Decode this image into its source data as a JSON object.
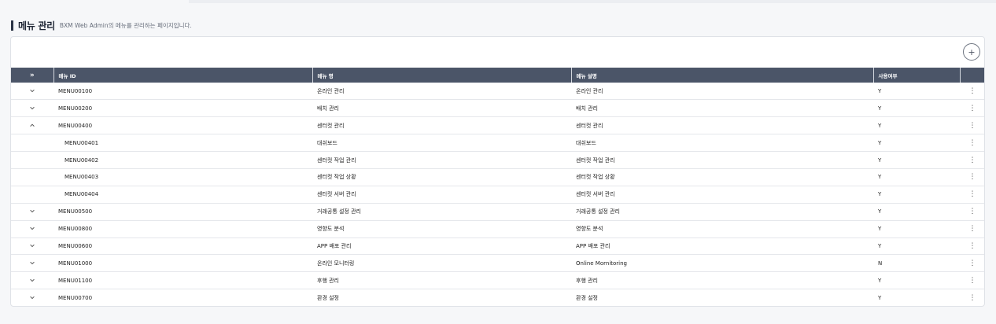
{
  "header": {
    "title": "메뉴 관리",
    "description": "BXM Web Admin의 메뉴를 관리하는 페이지입니다."
  },
  "toolbar": {
    "add_icon": "plus-icon",
    "add_label": "+"
  },
  "table": {
    "expand_all_icon": "double-chevron-right-icon",
    "expand_all_label": "»",
    "columns": [
      "메뉴 ID",
      "메뉴 명",
      "메뉴 설명",
      "사용여부"
    ],
    "rows": [
      {
        "id": "MENU00100",
        "name": "온라인 관리",
        "desc": "온라인 관리",
        "use": "Y",
        "toggle": "collapsed",
        "child": false
      },
      {
        "id": "MENU00200",
        "name": "배치 관리",
        "desc": "배치 관리",
        "use": "Y",
        "toggle": "collapsed",
        "child": false
      },
      {
        "id": "MENU00400",
        "name": "센터컷 관리",
        "desc": "센터컷 관리",
        "use": "Y",
        "toggle": "expanded",
        "child": false
      },
      {
        "id": "MENU00401",
        "name": "대쉬보드",
        "desc": "대쉬보드",
        "use": "Y",
        "toggle": "none",
        "child": true
      },
      {
        "id": "MENU00402",
        "name": "센터컷 작업 관리",
        "desc": "센터컷 작업 관리",
        "use": "Y",
        "toggle": "none",
        "child": true
      },
      {
        "id": "MENU00403",
        "name": "센터컷 작업 상황",
        "desc": "센터컷 작업 상황",
        "use": "Y",
        "toggle": "none",
        "child": true
      },
      {
        "id": "MENU00404",
        "name": "센터컷 서버 관리",
        "desc": "센터컷 서버 관리",
        "use": "Y",
        "toggle": "none",
        "child": true
      },
      {
        "id": "MENU00500",
        "name": "거래공통 설정 관리",
        "desc": "거래공통 설정 관리",
        "use": "Y",
        "toggle": "collapsed",
        "child": false
      },
      {
        "id": "MENU00800",
        "name": "영향도 분석",
        "desc": "영향도 분석",
        "use": "Y",
        "toggle": "collapsed",
        "child": false
      },
      {
        "id": "MENU00600",
        "name": "APP 배포 관리",
        "desc": "APP 배포 관리",
        "use": "Y",
        "toggle": "collapsed",
        "child": false
      },
      {
        "id": "MENU01000",
        "name": "온라인 모니터링",
        "desc": "Online Mornitoring",
        "use": "N",
        "toggle": "collapsed",
        "child": false
      },
      {
        "id": "MENU01100",
        "name": "후행 관리",
        "desc": "후행 관리",
        "use": "Y",
        "toggle": "collapsed",
        "child": false
      },
      {
        "id": "MENU00700",
        "name": "환경 설정",
        "desc": "환경 설정",
        "use": "Y",
        "toggle": "collapsed",
        "child": false
      }
    ],
    "row_more_icon": "vertical-ellipsis-icon",
    "row_more_label": "⋮"
  }
}
